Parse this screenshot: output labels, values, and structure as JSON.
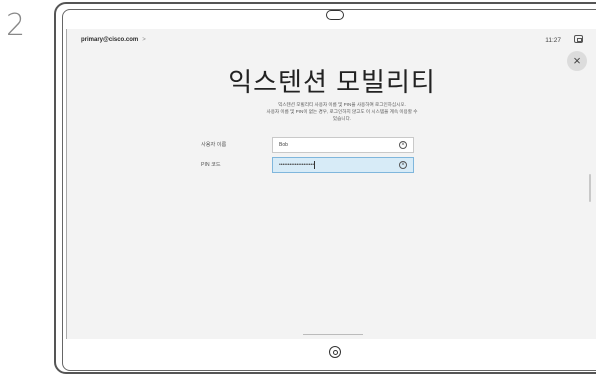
{
  "step_number": "2",
  "header": {
    "breadcrumb": "primary@cisco.com",
    "breadcrumb_chevron": ">",
    "time": "11:27"
  },
  "close_symbol": "×",
  "main": {
    "title": "익스텐션 모빌리티",
    "description_line1": "익스텐션 모빌리티 사용자 이름 및 PIN을 사용하여 로그인하십시오.",
    "description_line2": "사용자 이름 및 PIN이 없는 경우, 로그인하지 않고도 이 시스템을 계속 이용할 수",
    "description_line3": "있습니다.",
    "username_label": "사용자 이름",
    "username_value": "Bob",
    "pin_label": "PIN 코드",
    "pin_value": "••••••••••••••••••••"
  },
  "colors": {
    "active_field": "#d7ebf7",
    "screen_bg": "#f3f3f3"
  }
}
